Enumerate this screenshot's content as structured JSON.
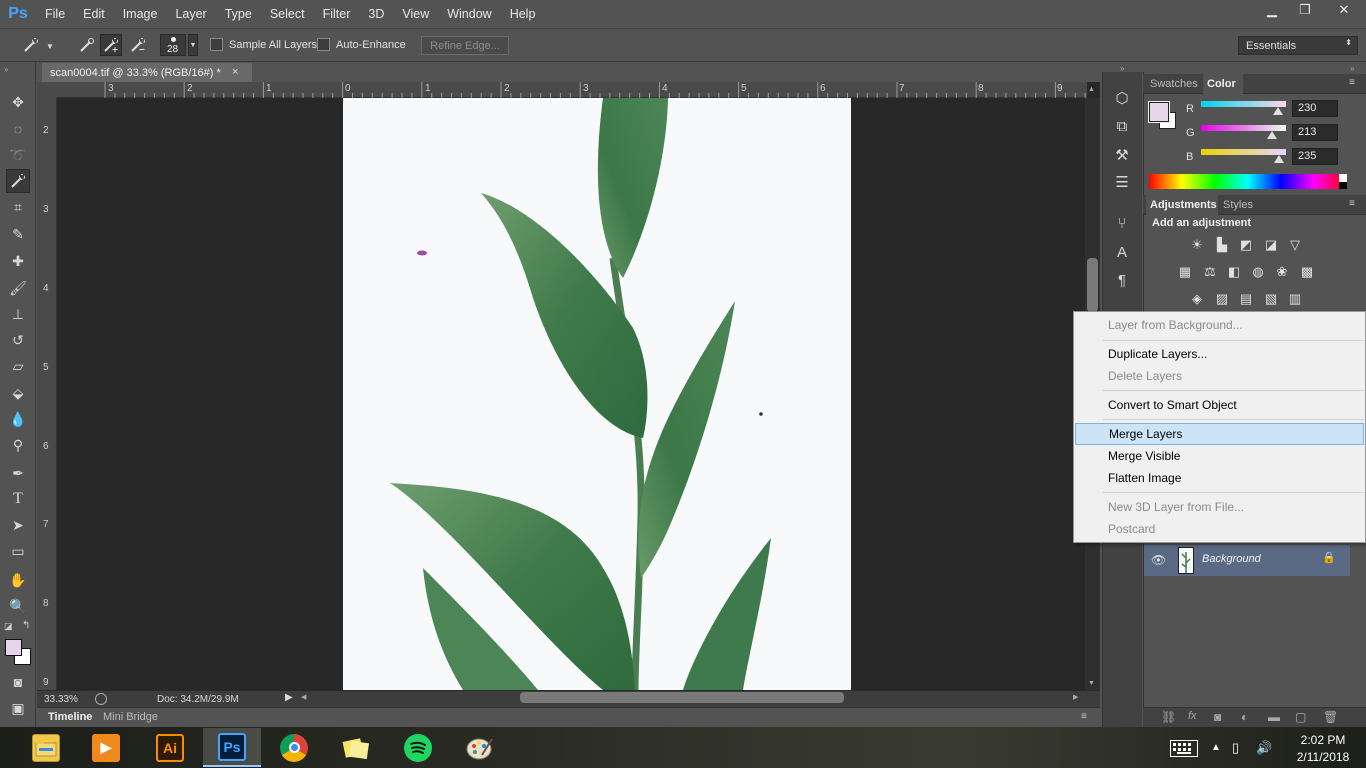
{
  "app": {
    "logo": "Ps",
    "menu": [
      "File",
      "Edit",
      "Image",
      "Layer",
      "Type",
      "Select",
      "Filter",
      "3D",
      "View",
      "Window",
      "Help"
    ],
    "window_controls": {
      "minimize": "▁",
      "restore": "❐",
      "close": "✕"
    }
  },
  "options": {
    "brush_size": "28",
    "sample_all_layers": "Sample All Layers",
    "auto_enhance": "Auto-Enhance",
    "refine_edge": "Refine Edge...",
    "workspace": "Essentials"
  },
  "document": {
    "tab_title": "scan0004.tif @ 33.3% (RGB/16#) *",
    "tab_close": "×",
    "ruler_top": [
      "3",
      "2",
      "1",
      "0",
      "1",
      "2",
      "3",
      "4",
      "5",
      "6",
      "7",
      "8",
      "9"
    ],
    "ruler_left": [
      "2",
      "3",
      "4",
      "5",
      "6",
      "7",
      "8",
      "9"
    ],
    "zoom": "33.33%",
    "doc_size": "Doc: 34.2M/29.9M"
  },
  "bottom_tabs": [
    "Timeline",
    "Mini Bridge"
  ],
  "color_panel": {
    "tabs": [
      "Swatches",
      "Color"
    ],
    "active_tab": "Color",
    "channels": [
      {
        "label": "R",
        "value": "230",
        "fraction": 0.902
      },
      {
        "label": "G",
        "value": "213",
        "fraction": 0.835
      },
      {
        "label": "B",
        "value": "235",
        "fraction": 0.922
      }
    ],
    "foreground": "#e6d5eb",
    "background": "#ffffff"
  },
  "adjustments_panel": {
    "tabs": [
      "Adjustments",
      "Styles"
    ],
    "heading": "Add an adjustment"
  },
  "context_menu": {
    "items": [
      {
        "label": "Layer from Background...",
        "disabled": true
      },
      {
        "label": "Duplicate Layers...",
        "disabled": false
      },
      {
        "label": "Delete Layers",
        "disabled": true
      },
      {
        "label": "Convert to Smart Object",
        "disabled": false
      },
      {
        "label": "Merge Layers",
        "disabled": false,
        "highlighted": true
      },
      {
        "label": "Merge Visible",
        "disabled": false
      },
      {
        "label": "Flatten Image",
        "disabled": false
      },
      {
        "label": "New 3D Layer from File...",
        "disabled": true
      },
      {
        "label": "Postcard",
        "disabled": true
      }
    ]
  },
  "layers": [
    {
      "name": "Background",
      "visible": true,
      "locked": true
    }
  ],
  "taskbar": {
    "time": "2:02 PM",
    "date": "2/11/2018",
    "apps": [
      "file-explorer",
      "media-player",
      "illustrator",
      "photoshop",
      "chrome",
      "sticky-notes",
      "spotify",
      "paint"
    ],
    "active_app": "photoshop",
    "illustrator_label": "Ai",
    "photoshop_label": "Ps"
  }
}
